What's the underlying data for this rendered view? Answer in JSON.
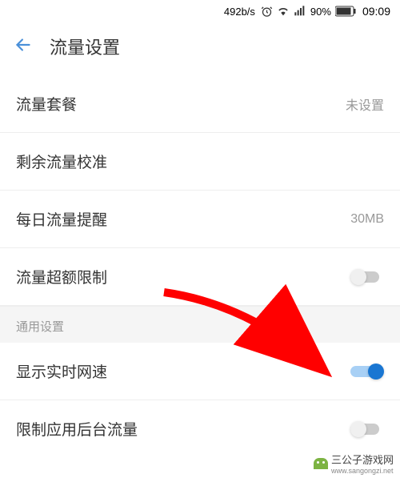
{
  "status_bar": {
    "speed": "492b/s",
    "battery_percent": "90%",
    "time": "09:09"
  },
  "header": {
    "title": "流量设置"
  },
  "sections": {
    "main": {
      "items": [
        {
          "label": "流量套餐",
          "value": "未设置"
        },
        {
          "label": "剩余流量校准",
          "value": ""
        },
        {
          "label": "每日流量提醒",
          "value": "30MB"
        },
        {
          "label": "流量超额限制",
          "toggle": "off"
        }
      ]
    },
    "general": {
      "header": "通用设置",
      "items": [
        {
          "label": "显示实时网速",
          "toggle": "on"
        },
        {
          "label": "限制应用后台流量",
          "toggle": "off"
        }
      ]
    }
  },
  "watermark": {
    "text": "三公子游戏网",
    "url": "www.sangongzi.net"
  }
}
